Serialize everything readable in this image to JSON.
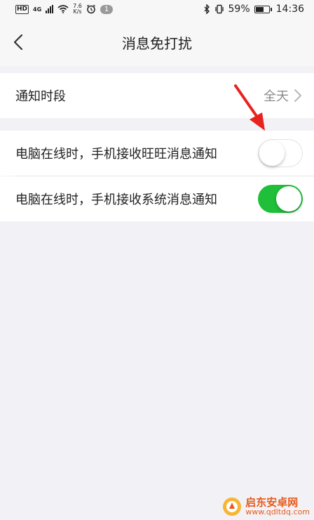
{
  "status_bar": {
    "network": "HD",
    "network_gen": "4G",
    "speed_value": "7.6",
    "speed_unit": "K/s",
    "notification_count": "1",
    "battery": "59%",
    "time": "14:36"
  },
  "header": {
    "title": "消息免打扰"
  },
  "settings": {
    "notify_period": {
      "label": "通知时段",
      "value": "全天"
    },
    "wangwang_toggle": {
      "label": "电脑在线时，手机接收旺旺消息通知",
      "enabled": false
    },
    "system_toggle": {
      "label": "电脑在线时，手机接收系统消息通知",
      "enabled": true
    }
  },
  "colors": {
    "toggle_on": "#1fbf3a",
    "annotation_arrow": "#e8231f",
    "watermark": "#e85a1c"
  },
  "watermark": {
    "name": "启东安卓网",
    "url": "www.qdltdq.com"
  }
}
